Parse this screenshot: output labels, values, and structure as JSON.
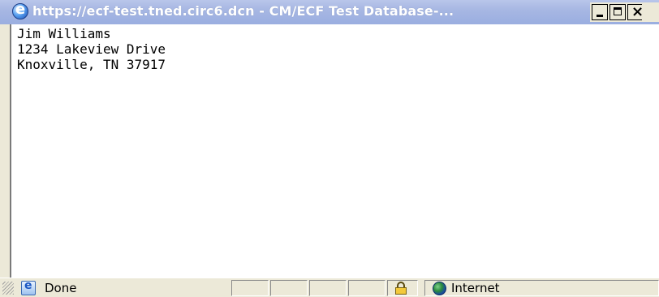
{
  "window": {
    "title": "https://ecf-test.tned.circ6.dcn - CM/ECF Test Database-...",
    "controls": {
      "minimize": "minimize",
      "maximize": "maximize",
      "close": "close"
    }
  },
  "content": {
    "address_lines": [
      "Jim Williams",
      "1234 Lakeview Drive",
      "Knoxville, TN 37917"
    ]
  },
  "statusbar": {
    "status": "Done",
    "zone": "Internet",
    "icons": [
      "ie-page-icon",
      "lock-icon",
      "globe-icon"
    ]
  },
  "colors": {
    "titlebar": "#9aaee0",
    "chrome": "#ece9d8",
    "text": "#000000",
    "background": "#ffffff"
  }
}
